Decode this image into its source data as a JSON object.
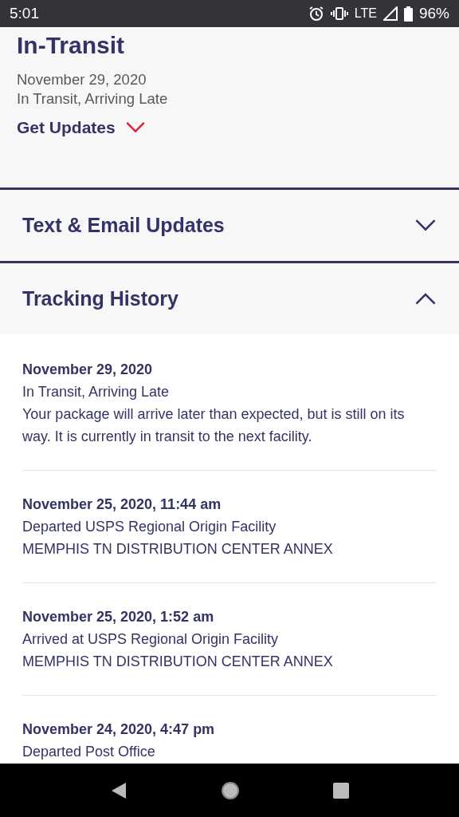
{
  "status_bar": {
    "time": "5:01",
    "network": "LTE",
    "battery": "96%"
  },
  "summary": {
    "title": "In-Transit",
    "date": "November 29, 2020",
    "status": "In Transit, Arriving Late",
    "updates_link": "Get Updates",
    "updates_expanded": false
  },
  "sections": [
    {
      "title": "Text & Email Updates",
      "expanded": false
    },
    {
      "title": "Tracking History",
      "expanded": true
    }
  ],
  "events": [
    {
      "date": "November 29, 2020",
      "lines": [
        "In Transit, Arriving Late",
        "Your package will arrive later than expected, but is still on its way. It is currently in transit to the next facility."
      ]
    },
    {
      "date": "November 25, 2020, 11:44 am",
      "lines": [
        "Departed USPS Regional Origin Facility",
        "MEMPHIS TN DISTRIBUTION CENTER ANNEX"
      ]
    },
    {
      "date": "November 25, 2020, 1:52 am",
      "lines": [
        "Arrived at USPS Regional Origin Facility",
        "MEMPHIS TN DISTRIBUTION CENTER ANNEX"
      ]
    },
    {
      "date": "November 24, 2020, 4:47 pm",
      "lines": [
        "Departed Post Office"
      ]
    }
  ]
}
